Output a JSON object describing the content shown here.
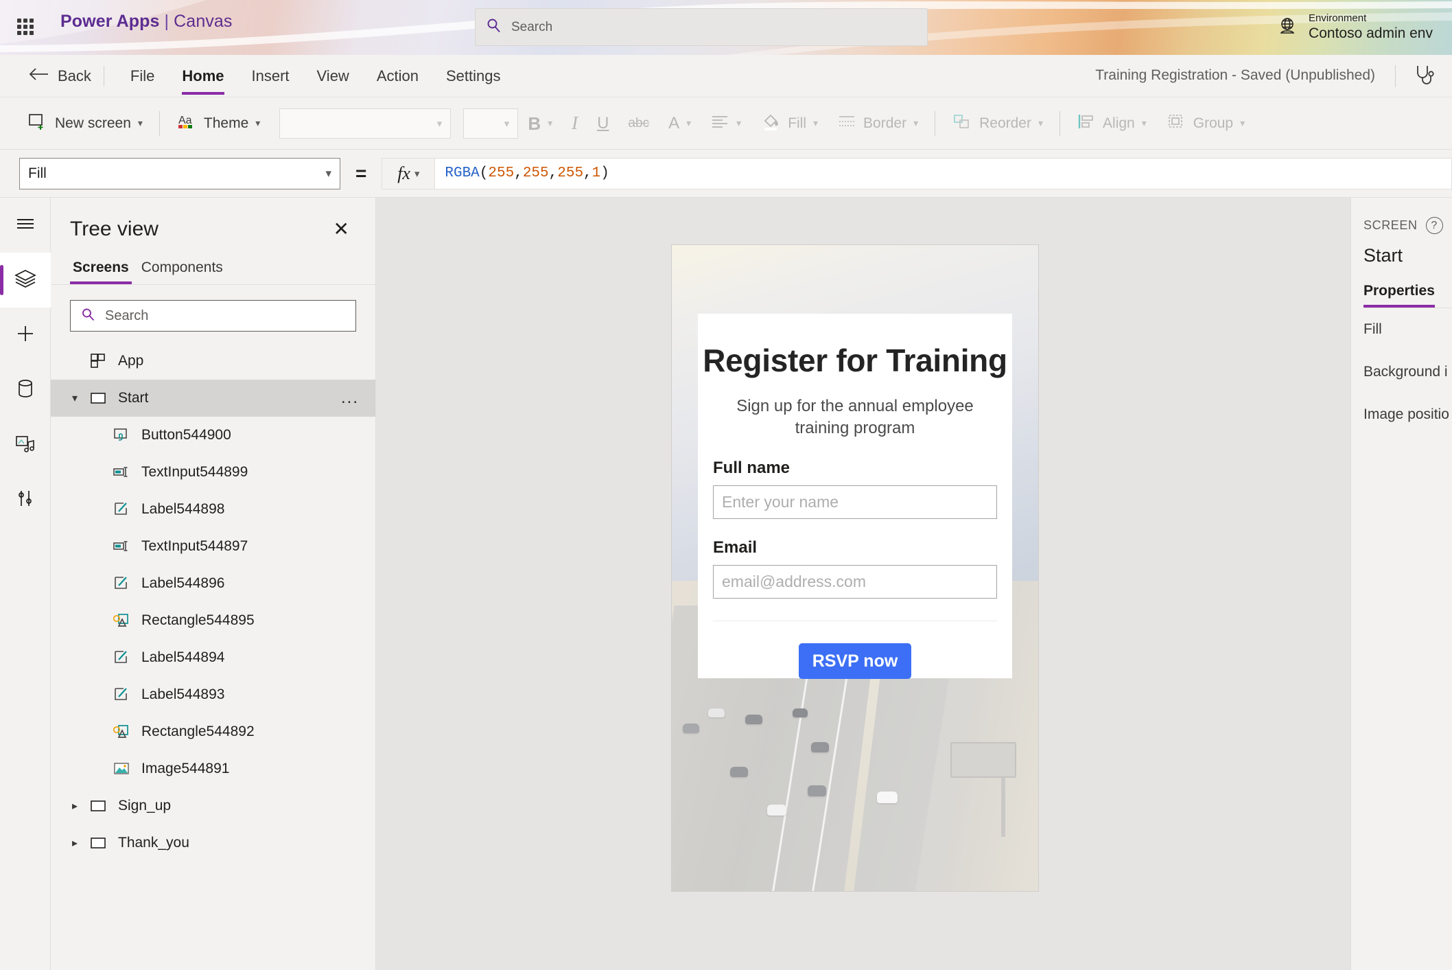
{
  "brand": {
    "waffle_icon": "app-launcher-icon",
    "product": "Power Apps",
    "separator": "|",
    "app_mode": "Canvas"
  },
  "search": {
    "icon": "search-icon",
    "placeholder": "Search",
    "value": ""
  },
  "environment": {
    "icon": "globe-icon",
    "label": "Environment",
    "name": "Contoso admin env"
  },
  "menubar": {
    "back_label": "Back",
    "back_icon": "arrow-left-icon",
    "items": [
      {
        "label": "File",
        "active": false
      },
      {
        "label": "Home",
        "active": true
      },
      {
        "label": "Insert",
        "active": false
      },
      {
        "label": "View",
        "active": false
      },
      {
        "label": "Action",
        "active": false
      },
      {
        "label": "Settings",
        "active": false
      }
    ],
    "app_status": "Training Registration - Saved (Unpublished)",
    "checker_icon": "app-checker-stethoscope-icon"
  },
  "ribbon": {
    "new_screen": {
      "label": "New screen",
      "icon": "new-screen-icon",
      "enabled": true
    },
    "theme": {
      "label": "Theme",
      "icon": "theme-aa-icon",
      "enabled": true
    },
    "font_family": {
      "value": "",
      "enabled": false
    },
    "font_size": {
      "value": "",
      "enabled": false
    },
    "bold": {
      "label": "B",
      "icon": "bold-icon",
      "enabled": false
    },
    "italic": {
      "label": "I",
      "icon": "italic-icon",
      "enabled": false
    },
    "underline": {
      "label": "U",
      "icon": "underline-icon",
      "enabled": false
    },
    "strikethrough": {
      "label": "abc",
      "icon": "strikethrough-icon",
      "enabled": false
    },
    "font_color": {
      "label": "A",
      "icon": "font-color-icon",
      "enabled": false
    },
    "align": {
      "icon": "text-align-icon",
      "enabled": false
    },
    "fill": {
      "label": "Fill",
      "icon": "fill-bucket-icon",
      "enabled": false
    },
    "border": {
      "label": "Border",
      "icon": "border-icon",
      "enabled": false
    },
    "reorder": {
      "label": "Reorder",
      "icon": "reorder-icon",
      "enabled": false
    },
    "align_objects": {
      "label": "Align",
      "icon": "align-objects-icon",
      "enabled": false
    },
    "group": {
      "label": "Group",
      "icon": "group-icon",
      "enabled": false
    }
  },
  "formula_bar": {
    "property": "Fill",
    "equals": "=",
    "fx_label": "fx",
    "expression": {
      "function": "RGBA",
      "open_paren": "(",
      "args": [
        "255",
        "255",
        "255",
        "1"
      ],
      "separator": ", ",
      "close_paren": ")",
      "full_text": "RGBA(255, 255, 255, 1)"
    }
  },
  "rail": {
    "items": [
      {
        "name": "menu-hamburger",
        "icon": "hamburger-icon",
        "active": false
      },
      {
        "name": "tree-view",
        "icon": "layers-icon",
        "active": true
      },
      {
        "name": "insert",
        "icon": "plus-icon",
        "active": false
      },
      {
        "name": "data",
        "icon": "database-cylinder-icon",
        "active": false
      },
      {
        "name": "media",
        "icon": "media-music-icon",
        "active": false
      },
      {
        "name": "variables",
        "icon": "sliders-icon",
        "active": false
      }
    ]
  },
  "tree_view": {
    "title": "Tree view",
    "close_icon": "close-icon",
    "tabs": [
      {
        "label": "Screens",
        "active": true
      },
      {
        "label": "Components",
        "active": false
      }
    ],
    "search": {
      "icon": "search-icon",
      "placeholder": "Search",
      "value": ""
    },
    "nodes": [
      {
        "label": "App",
        "icon": "app-icon",
        "indent": 1,
        "expander": "",
        "selected": false,
        "overflow": false
      },
      {
        "label": "Start",
        "icon": "screen-icon",
        "indent": 1,
        "expander": "chevron-down-icon",
        "selected": true,
        "overflow": true,
        "overflow_label": "..."
      },
      {
        "label": "Button544900",
        "icon": "button-control-icon",
        "indent": 2,
        "expander": "",
        "selected": false,
        "overflow": false
      },
      {
        "label": "TextInput544899",
        "icon": "text-input-control-icon",
        "indent": 2,
        "expander": "",
        "selected": false,
        "overflow": false
      },
      {
        "label": "Label544898",
        "icon": "label-control-icon",
        "indent": 2,
        "expander": "",
        "selected": false,
        "overflow": false
      },
      {
        "label": "TextInput544897",
        "icon": "text-input-control-icon",
        "indent": 2,
        "expander": "",
        "selected": false,
        "overflow": false
      },
      {
        "label": "Label544896",
        "icon": "label-control-icon",
        "indent": 2,
        "expander": "",
        "selected": false,
        "overflow": false
      },
      {
        "label": "Rectangle544895",
        "icon": "shape-rectangle-icon",
        "indent": 2,
        "expander": "",
        "selected": false,
        "overflow": false
      },
      {
        "label": "Label544894",
        "icon": "label-control-icon",
        "indent": 2,
        "expander": "",
        "selected": false,
        "overflow": false
      },
      {
        "label": "Label544893",
        "icon": "label-control-icon",
        "indent": 2,
        "expander": "",
        "selected": false,
        "overflow": false
      },
      {
        "label": "Rectangle544892",
        "icon": "shape-rectangle-icon",
        "indent": 2,
        "expander": "",
        "selected": false,
        "overflow": false
      },
      {
        "label": "Image544891",
        "icon": "image-control-icon",
        "indent": 2,
        "expander": "",
        "selected": false,
        "overflow": false
      },
      {
        "label": "Sign_up",
        "icon": "screen-icon",
        "indent": 1,
        "expander": "chevron-right-icon",
        "selected": false,
        "overflow": false
      },
      {
        "label": "Thank_you",
        "icon": "screen-icon",
        "indent": 1,
        "expander": "chevron-right-icon",
        "selected": false,
        "overflow": false
      }
    ]
  },
  "canvas": {
    "screen_name": "Start",
    "background_image": "highway-traffic-photo",
    "card": {
      "title": "Register for Training",
      "subtitle": "Sign up for the annual employee training program",
      "fields": [
        {
          "label": "Full name",
          "placeholder": "Enter your name",
          "value": ""
        },
        {
          "label": "Email",
          "placeholder": "email@address.com",
          "value": ""
        }
      ],
      "submit_button": {
        "label": "RSVP now",
        "color": "#3c6ff5",
        "text_color": "#ffffff"
      }
    }
  },
  "properties_panel": {
    "kicker": "SCREEN",
    "help_icon": "help-question-icon",
    "selected_name": "Start",
    "tabs": [
      {
        "label": "Properties",
        "active": true
      }
    ],
    "rows": [
      {
        "label": "Fill"
      },
      {
        "label": "Background i"
      },
      {
        "label": "Image positio"
      }
    ]
  },
  "colors": {
    "accent_purple": "#8a2da5",
    "brand_purple": "#5c2d91",
    "button_blue": "#3c6ff5",
    "chrome_gray": "#f3f2f1",
    "canvas_gray": "#e6e4e2"
  }
}
